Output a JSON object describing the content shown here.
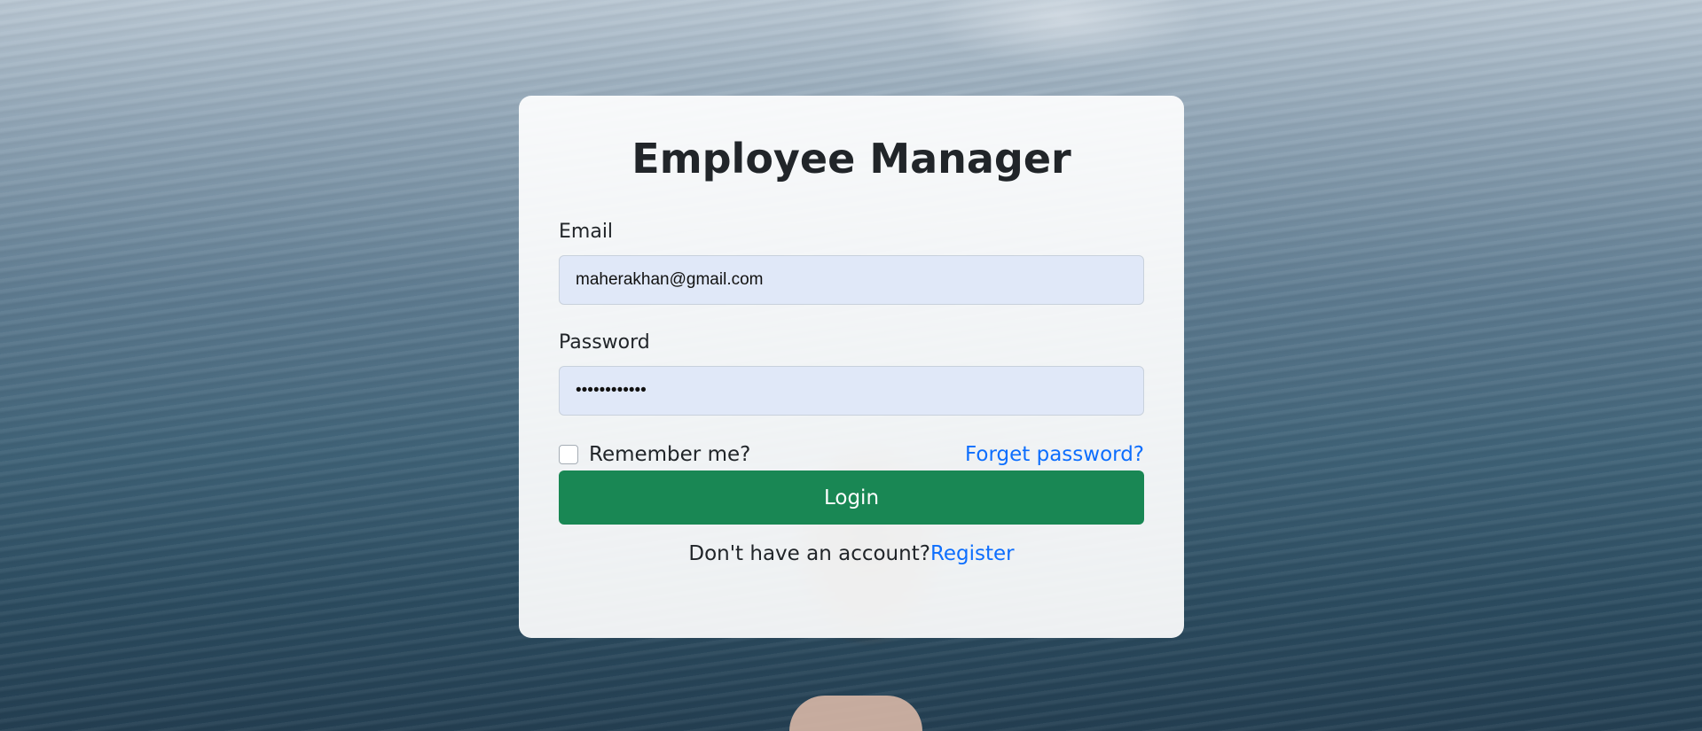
{
  "app": {
    "title": "Employee Manager"
  },
  "form": {
    "email_label": "Email",
    "email_value": "maherakhan@gmail.com",
    "password_label": "Password",
    "password_value": "maherakhan12",
    "remember_label": "Remember me?",
    "remember_checked": false,
    "forgot_link": "Forget password?",
    "login_button": "Login",
    "no_account_text": "Don't have an account?",
    "register_link": "Register"
  },
  "colors": {
    "primary_button": "#198754",
    "link": "#0d6efd",
    "input_bg": "#e0e8f8"
  }
}
